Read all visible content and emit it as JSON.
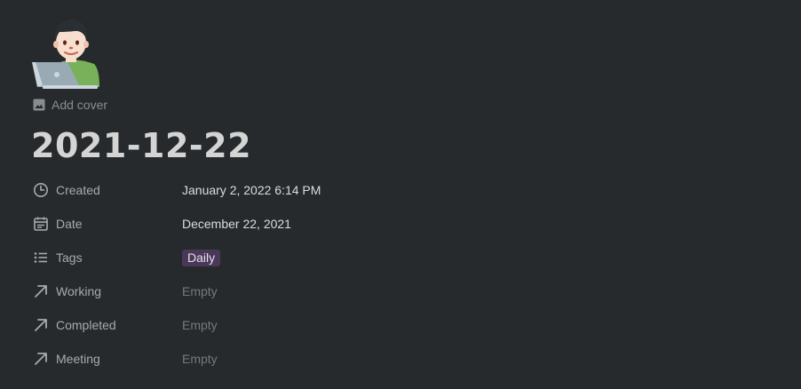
{
  "page": {
    "icon": "technologist-emoji-icon",
    "add_cover_label": "Add cover",
    "title": "2021-12-22"
  },
  "properties": [
    {
      "icon": "clock-icon",
      "name": "Created",
      "value": "January 2, 2022 6:14 PM"
    },
    {
      "icon": "calendar-icon",
      "name": "Date",
      "value": "December 22, 2021"
    },
    {
      "icon": "list-icon",
      "name": "Tags",
      "tag": "Daily"
    },
    {
      "icon": "relation-arrow-icon",
      "name": "Working",
      "value": "Empty"
    },
    {
      "icon": "relation-arrow-icon",
      "name": "Completed",
      "value": "Empty"
    },
    {
      "icon": "relation-arrow-icon",
      "name": "Meeting",
      "value": "Empty"
    }
  ],
  "colors": {
    "background": "#262a2c",
    "tag_background": "#4a3858",
    "muted_text": "#76797b"
  }
}
